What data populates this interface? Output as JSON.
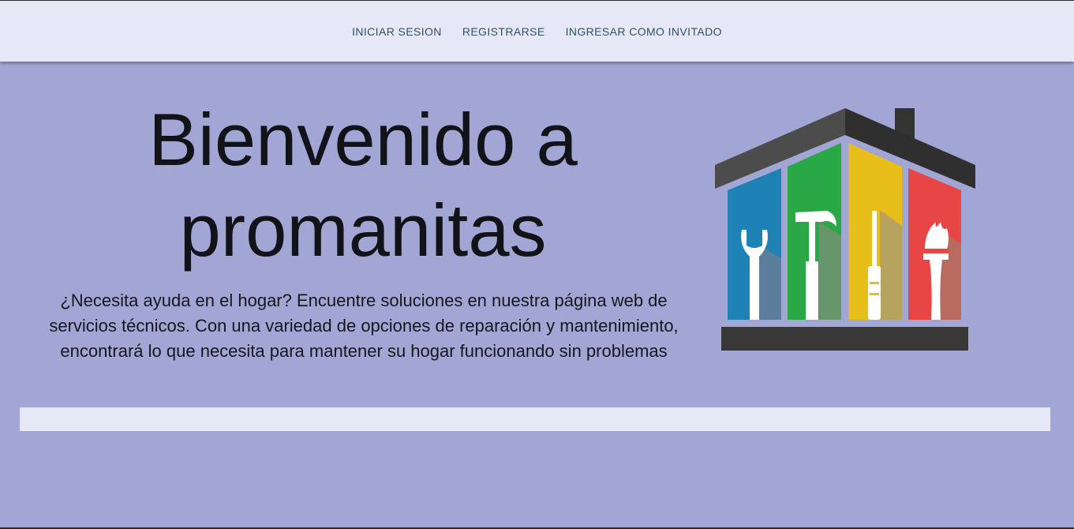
{
  "nav": {
    "items": [
      {
        "label": "INICIAR SESION"
      },
      {
        "label": "REGISTRARSE"
      },
      {
        "label": "INGRESAR COMO INVITADO"
      }
    ]
  },
  "hero": {
    "title": "Bienvenido a promanitas",
    "description": "¿Necesita ayuda en el hogar? Encuentre soluciones en nuestra página web de servicios técnicos. Con una variedad de opciones de reparación y mantenimiento, encontrará lo que necesita para mantener su hogar funcionando sin problemas"
  },
  "logo": {
    "icon": "house-tools-logo",
    "colors": {
      "roof": "#3a3a3a",
      "blue": "#1e82b4",
      "green": "#2aa845",
      "yellow": "#e8bf1a",
      "red": "#e84545",
      "background": "#a2a6d4"
    }
  },
  "colors": {
    "page_background": "#a2a6d4",
    "navbar_background": "#e7e8f6",
    "nav_text": "#2f4f6f",
    "footer_bar": "#e7e8f6"
  }
}
